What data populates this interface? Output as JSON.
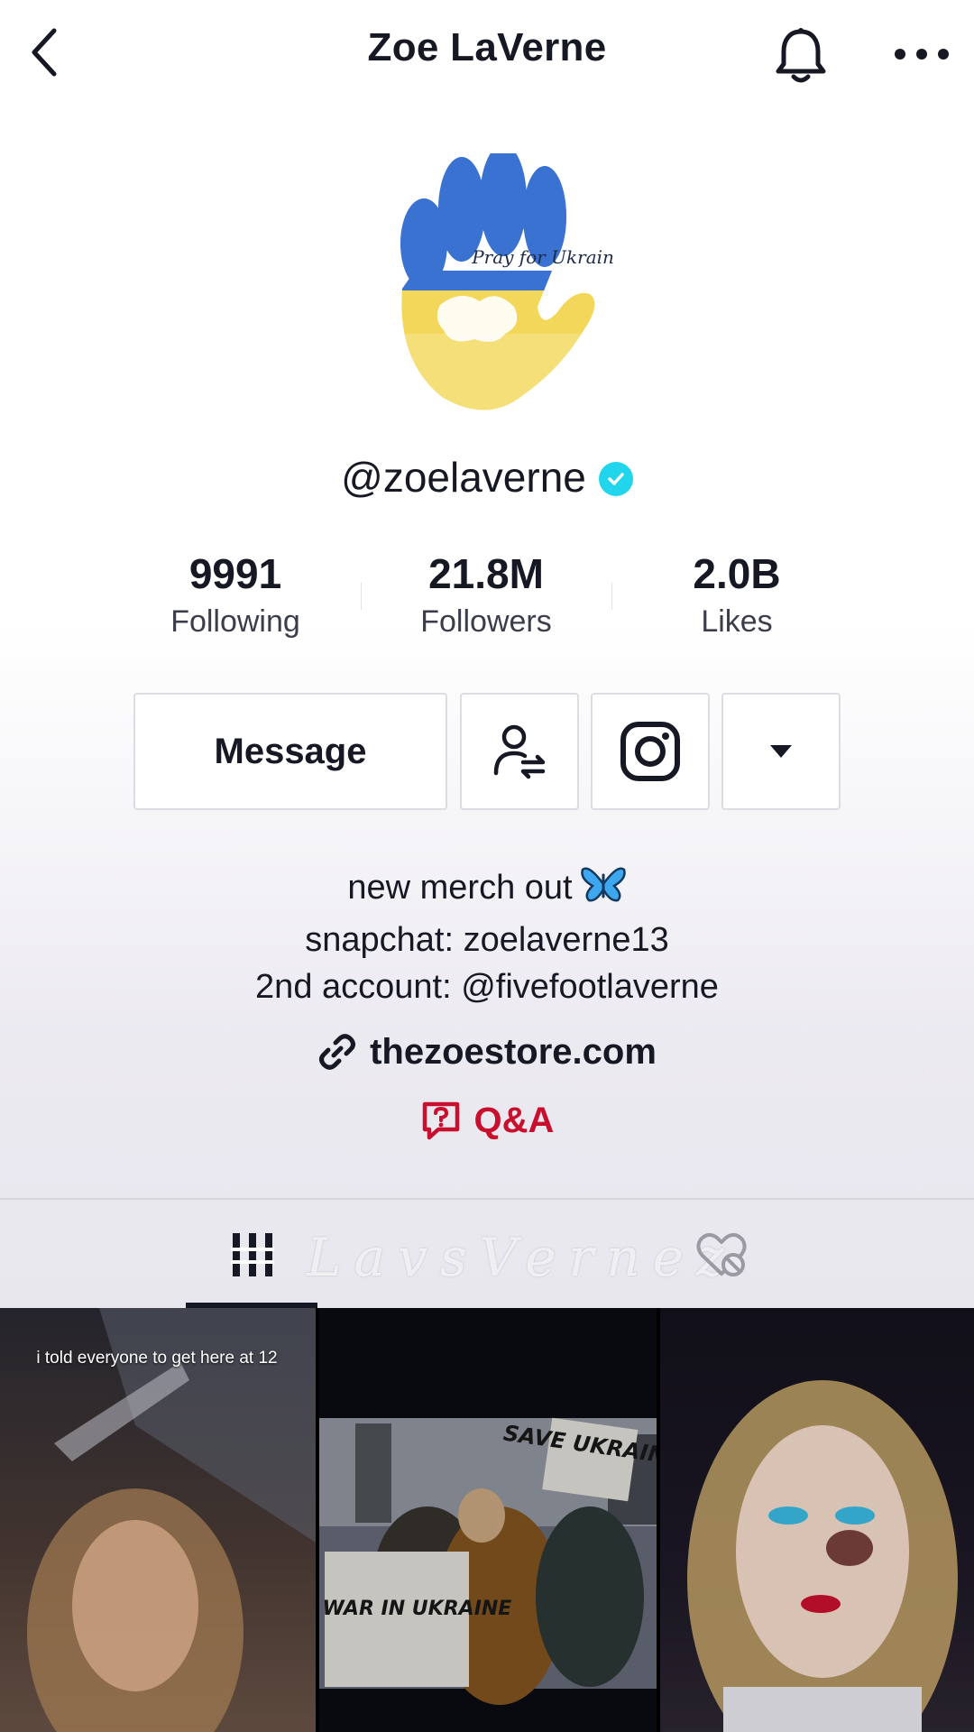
{
  "header": {
    "title": "Zoe LaVerne",
    "back_icon": "chevron-left-icon",
    "bell_icon": "bell-icon",
    "more_icon": "more-horizontal-icon"
  },
  "profile": {
    "avatar_text": "Pray for Ukraine!",
    "username": "@zoelaverne",
    "verified": true,
    "verified_color": "#20d5ec"
  },
  "stats": [
    {
      "value": "9991",
      "label": "Following"
    },
    {
      "value": "21.8M",
      "label": "Followers"
    },
    {
      "value": "2.0B",
      "label": "Likes"
    }
  ],
  "actions": {
    "message_label": "Message",
    "follow_icon": "user-swap-icon",
    "instagram_icon": "instagram-icon",
    "more_icon": "caret-down-icon"
  },
  "bio": {
    "line1": "new merch out",
    "line1_emoji": "butterfly-icon",
    "line2": "snapchat: zoelaverne13",
    "line3": "2nd account: @fivefootlaverne"
  },
  "link": {
    "text": "thezoestore.com",
    "icon": "link-icon"
  },
  "qa": {
    "text": "Q&A",
    "icon": "question-bubble-icon",
    "color": "#c8102e"
  },
  "tabs": {
    "videos_icon": "grid-icon",
    "liked_icon": "hidden-heart-icon",
    "active": "videos"
  },
  "watermark": "LavsVernez",
  "grid": [
    {
      "caption": "i told everyone to get here at 12"
    },
    {
      "sign1": "SAVE UKRAINE",
      "sign2": "NO WAR IN UKRAINE"
    },
    {
      "caption": ""
    }
  ],
  "colors": {
    "accent_red": "#c8102e",
    "text": "#161823",
    "verified": "#20d5ec"
  }
}
